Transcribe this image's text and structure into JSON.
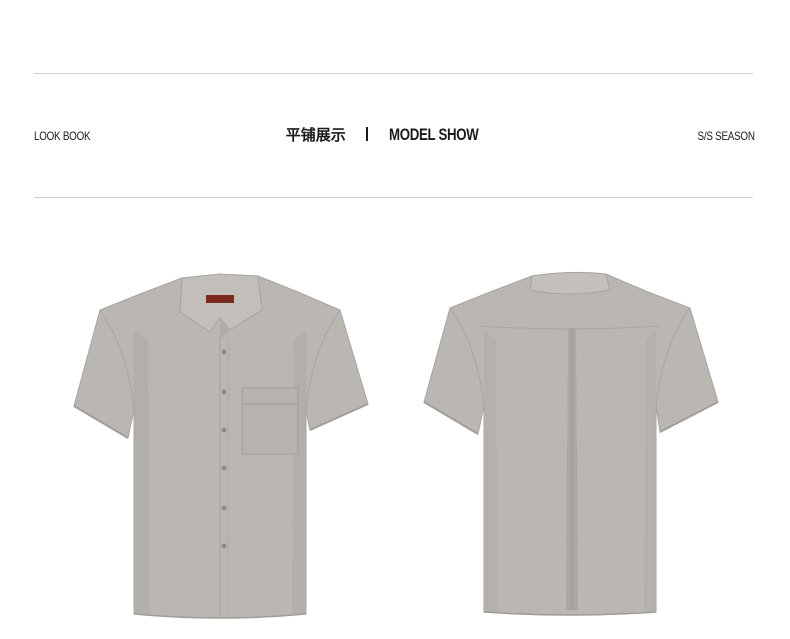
{
  "header": {
    "left_label": "LOOK BOOK",
    "title_cn": "平铺展示",
    "title_en": "MODEL SHOW",
    "right_label": "S/S SEASON"
  },
  "product": {
    "front_image": "short-sleeve-shirt-front",
    "back_image": "short-sleeve-shirt-back",
    "fabric_color": "#b9b5b1",
    "shade_color": "#a9a5a1",
    "label_color": "#7a2a1e"
  }
}
